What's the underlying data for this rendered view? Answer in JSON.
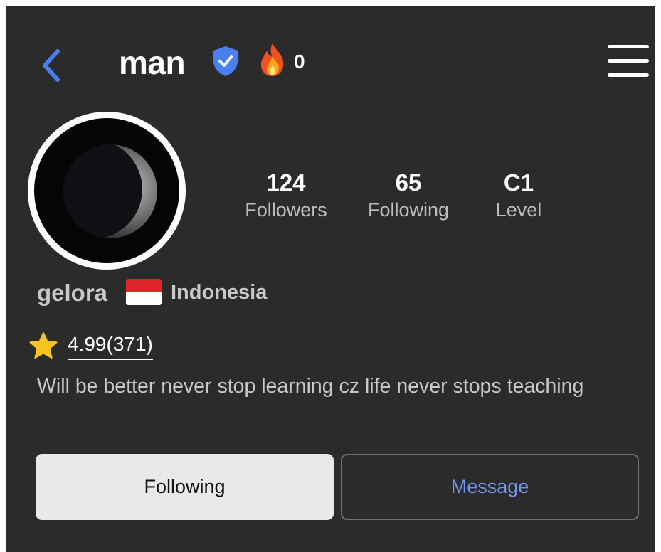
{
  "header": {
    "username": "man",
    "fire_count": "0",
    "back_icon": "chevron-left-icon",
    "verified_icon": "verified-shield-icon",
    "fire_icon": "fire-icon",
    "menu_icon": "hamburger-menu-icon"
  },
  "profile": {
    "avatar": "crescent-moon-avatar",
    "stats": [
      {
        "value": "124",
        "label": "Followers"
      },
      {
        "value": "65",
        "label": "Following"
      },
      {
        "value": "C1",
        "label": "Level"
      }
    ],
    "handle": "gelora",
    "country": "Indonesia",
    "flag_icon": "indonesia-flag-icon",
    "rating": "4.99(371)",
    "rating_icon": "star-icon",
    "bio": "Will be better never stop learning cz life never stops teaching"
  },
  "actions": {
    "following_label": "Following",
    "message_label": "Message"
  },
  "colors": {
    "background": "#2b2b2b",
    "accent_blue": "#6f96ec",
    "verified_blue": "#4a7ff0",
    "star_yellow": "#f7c51e"
  }
}
